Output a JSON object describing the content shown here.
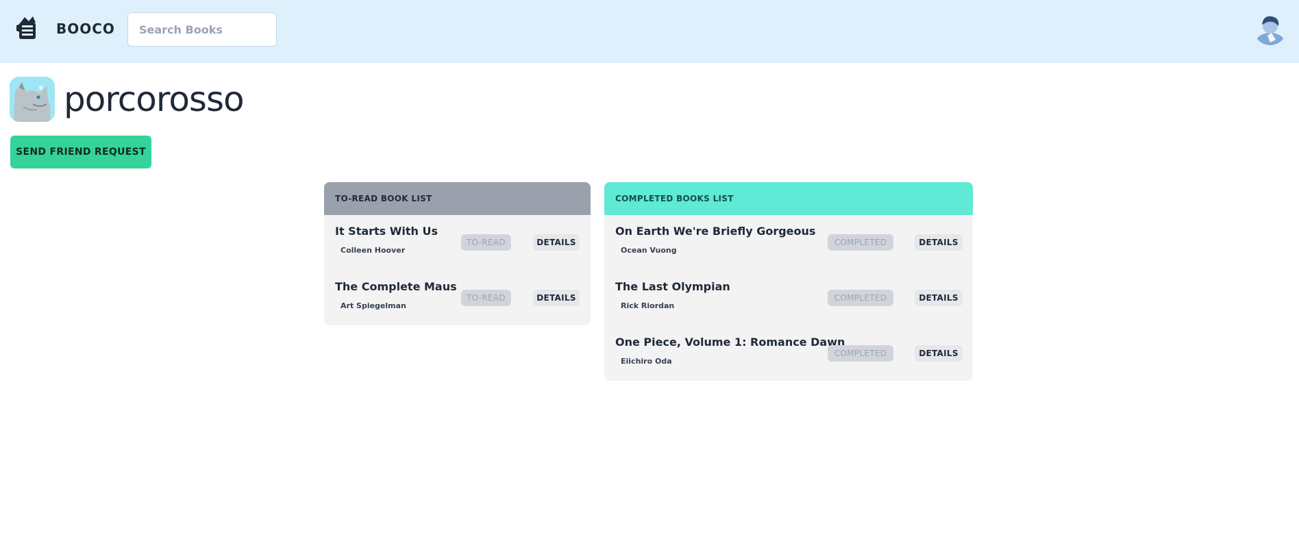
{
  "navbar": {
    "brand": "BOOCO",
    "search_placeholder": "Search Books",
    "logo_icon": "book-logo-icon",
    "avatar_icon": "user-avatar-icon",
    "background": "#dff0fd"
  },
  "profile": {
    "username": "porcorosso",
    "avatar_icon": "cat-avatar-icon",
    "friend_button_label": "SEND FRIEND REQUEST",
    "accent": "#34d399"
  },
  "to_read": {
    "title": "TO-READ BOOK LIST",
    "header_color": "#9aa1ad",
    "books": [
      {
        "title": "It Starts With Us",
        "author": "Colleen Hoover",
        "status": "TO-READ",
        "action": "DETAILS"
      },
      {
        "title": "The Complete Maus",
        "author": "Art Spiegelman",
        "status": "TO-READ",
        "action": "DETAILS"
      }
    ]
  },
  "completed": {
    "title": "COMPLETED BOOKS LIST",
    "header_color": "#5eead4",
    "books": [
      {
        "title": "On Earth We're Briefly Gorgeous",
        "author": "Ocean Vuong",
        "status": "COMPLETED",
        "action": "DETAILS"
      },
      {
        "title": "The Last Olympian",
        "author": "Rick Riordan",
        "status": "COMPLETED",
        "action": "DETAILS"
      },
      {
        "title": "One Piece, Volume 1: Romance Dawn",
        "author": "Eiichiro Oda",
        "status": "COMPLETED",
        "action": "DETAILS"
      }
    ]
  }
}
